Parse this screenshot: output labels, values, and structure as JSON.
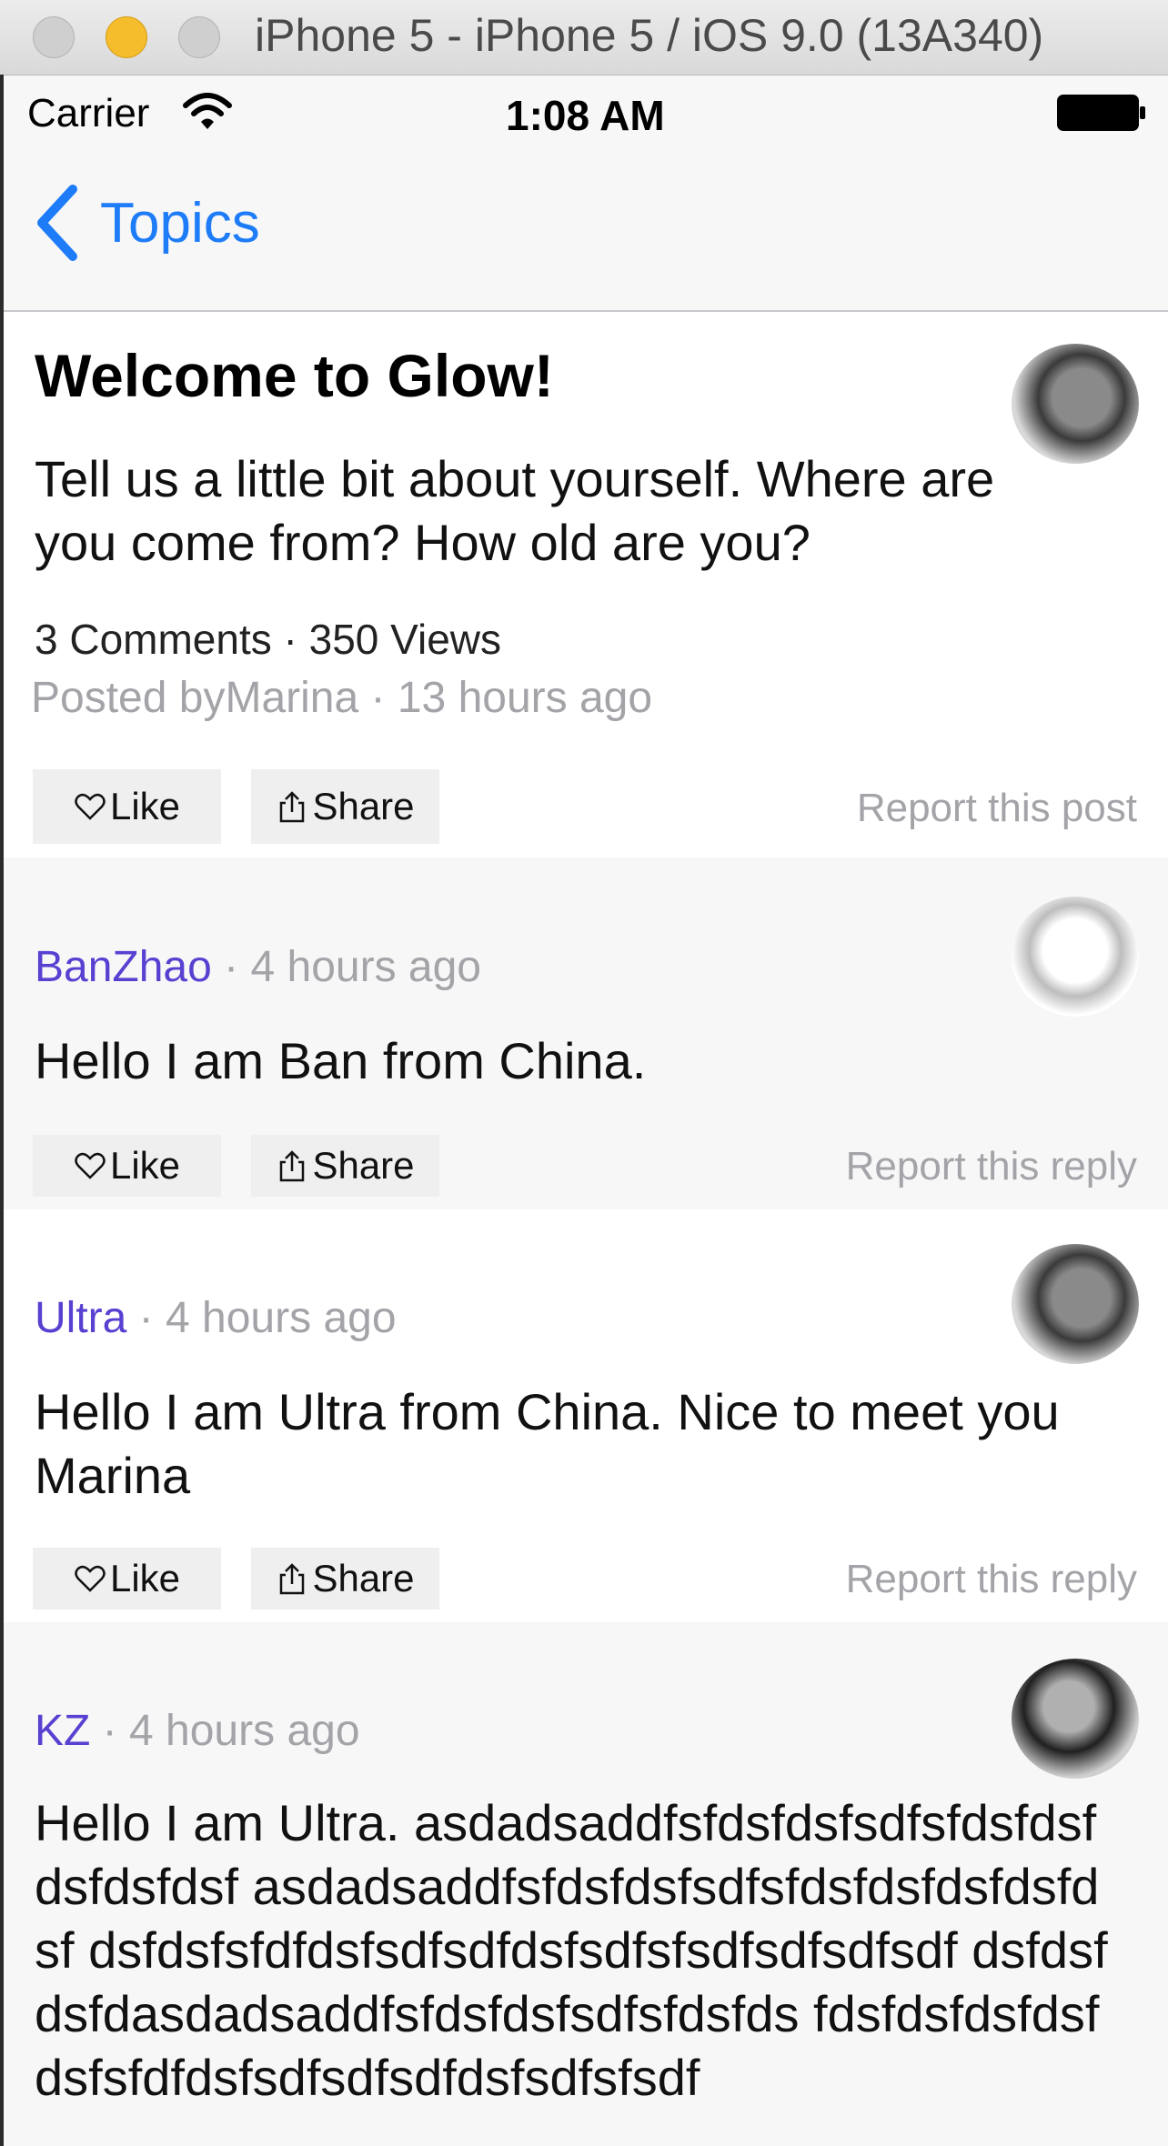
{
  "window": {
    "title": "iPhone 5 - iPhone 5 / iOS 9.0 (13A340)"
  },
  "status_bar": {
    "carrier": "Carrier",
    "time": "1:08 AM"
  },
  "nav": {
    "back_label": "Topics"
  },
  "post": {
    "title": "Welcome to Glow!",
    "body": "Tell us a little bit about yourself. Where are you come from? How old are you?",
    "stats": "3 Comments · 350 Views",
    "posted": "Posted byMarina · 13 hours ago",
    "like_label": "Like",
    "share_label": "Share",
    "report_label": "Report this post"
  },
  "replies": [
    {
      "author": "BanZhao",
      "time": " · 4 hours ago",
      "body": "Hello I am Ban from China.",
      "like_label": "Like",
      "share_label": "Share",
      "report_label": "Report this reply"
    },
    {
      "author": "Ultra",
      "time": " · 4 hours ago",
      "body": "Hello I am Ultra from China. Nice to meet you Marina",
      "like_label": "Like",
      "share_label": "Share",
      "report_label": "Report this reply"
    },
    {
      "author": "KZ",
      "time": " · 4 hours ago",
      "body": "Hello I am Ultra. asdadsaddfsfdsfdsfsdfsfdsfdsfdsfdsfdsf asdadsaddfsfdsfdsfsdfsfdsfdsfdsfdsfdsf dsfdsfsfdfdsfsdfsdfdsfsdfsfsdfsdfsdfsdf dsfdsfdsfdasdadsaddfsfdsfdsfsdfsfdsfds fdsfdsfdsfdsfdsfsfdfdsfsdfsdfsdfdsfsdfsfsdf"
    }
  ],
  "colors": {
    "accent": "#1e7cf8",
    "author": "#5940d1",
    "muted": "#a3a3a8"
  }
}
